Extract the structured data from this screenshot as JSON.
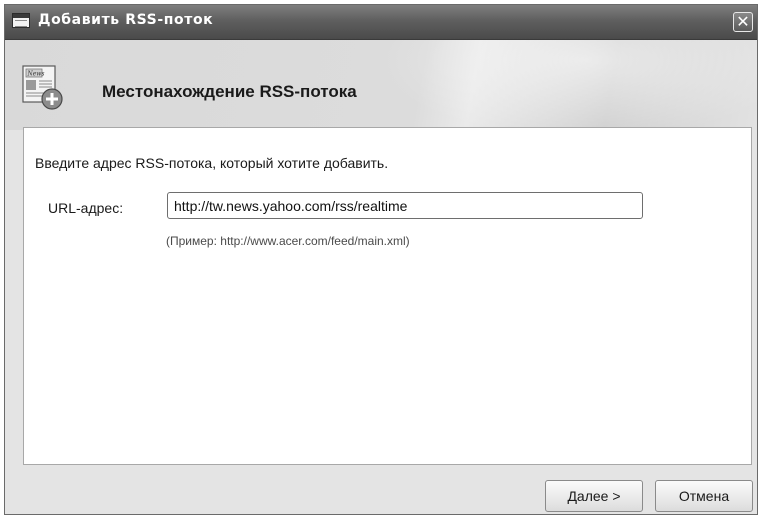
{
  "window": {
    "title": "Добавить RSS-поток",
    "close_symbol": "✕"
  },
  "header": {
    "title": "Местонахождение RSS-потока",
    "icon_text": "News"
  },
  "form": {
    "instruction": "Введите адрес RSS-потока, который хотите добавить.",
    "url_label": "URL-адрес:",
    "url_value": "http://tw.news.yahoo.com/rss/realtime",
    "example": "(Пример: http://www.acer.com/feed/main.xml)"
  },
  "buttons": {
    "next": "Далее >",
    "cancel": "Отмена"
  },
  "icons": {
    "title": "window-app-icon",
    "close": "close-icon",
    "header": "rss-news-add-icon"
  }
}
